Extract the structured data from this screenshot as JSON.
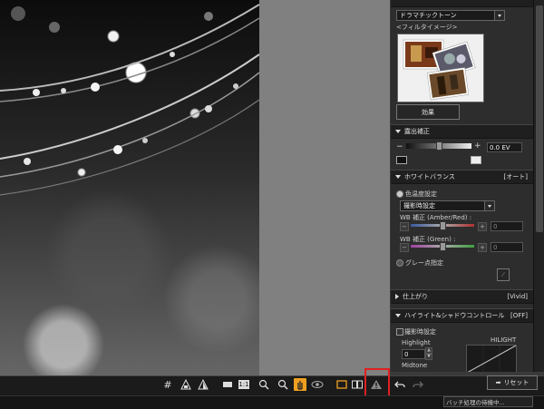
{
  "filter": {
    "selected": "ドラマチックトーン",
    "image_label": "<フィルタイメージ>",
    "effect_button": "効果"
  },
  "exposure": {
    "title": "露出補正",
    "value": "0.0 EV",
    "minus": "−",
    "plus": "+"
  },
  "white_balance": {
    "title": "ホワイトバランス",
    "badge": "[オート]",
    "radio_temp": "色温度設定",
    "preset": "撮影時設定",
    "amber_red_label": "WB 補正 (Amber/Red) :",
    "amber_red_value": "0",
    "green_label": "WB 補正 (Green) :",
    "green_value": "0",
    "radio_gray": "グレー点指定"
  },
  "finishing": {
    "title": "仕上がり",
    "badge": "[Vivid]"
  },
  "highlight_shadow": {
    "title": "ハイライト&シャドウコントロール",
    "badge": "[OFF]",
    "checkbox_label": "撮影時設定",
    "highlight_label": "Highlight",
    "highlight_value": "0",
    "midtone_label": "Midtone",
    "curve_label": "HILIGHT"
  },
  "toolbar": {
    "zoom_100": "1:1",
    "reset_label": "リセット"
  },
  "status": {
    "text": "バッチ処理の待機中..."
  },
  "colors": {
    "warning_highlight": "#e02020",
    "active_tool": "#f0a020"
  }
}
